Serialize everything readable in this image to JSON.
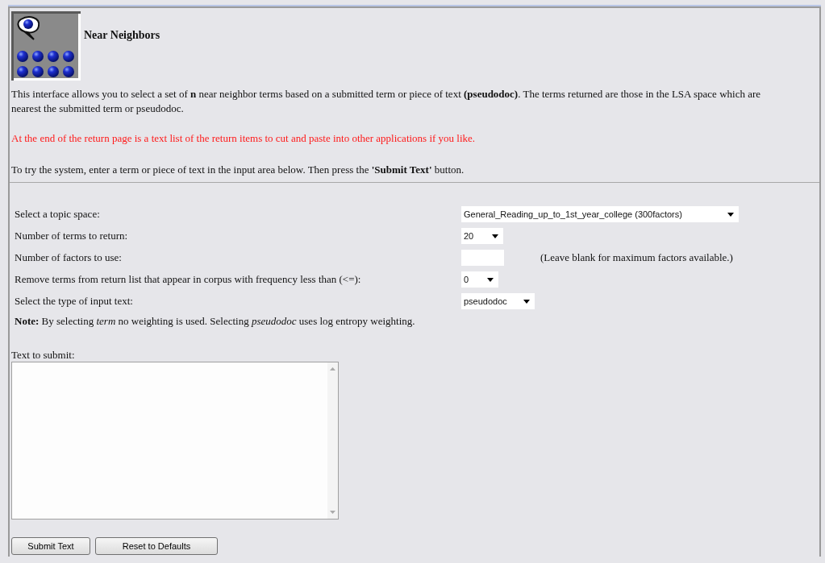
{
  "title": "Near Neighbors",
  "intro": "This interface allows you to select a set of **n** near neighbor terms based on a submitted term or piece of text **(pseudodoc)**. The terms returned are those in the LSA space which are nearest the submitted term or pseudodoc.",
  "notice": "At the end of the return page is a text list of the return items to cut and paste into other applications if you like.",
  "instructions": "To try the system, enter a term or piece of text in the input area below. Then press the **'Submit Text'** button.",
  "form_rows": [
    {
      "kind": "select",
      "label": "Select a topic space:",
      "value": "General_Reading_up_to_1st_year_college (300factors)"
    },
    {
      "kind": "select",
      "label": "Number of terms to return:",
      "value": "20"
    },
    {
      "kind": "input",
      "label": "Number of factors to use:",
      "hint": "(Leave blank for maximum factors available.)"
    },
    {
      "kind": "select",
      "label": "Remove terms from return list that appear in corpus with frequency less than (<=):",
      "value": "0"
    },
    {
      "kind": "select",
      "label": "Select the type of input text:",
      "value": "pseudodoc"
    }
  ],
  "note": "**Note:** By selecting *term* no weighting is used. Selecting *pseudodoc* uses log entropy weighting.",
  "text_area": {
    "label": "Text to submit:"
  },
  "buttons": [
    "Submit Text",
    "Reset to Defaults"
  ]
}
